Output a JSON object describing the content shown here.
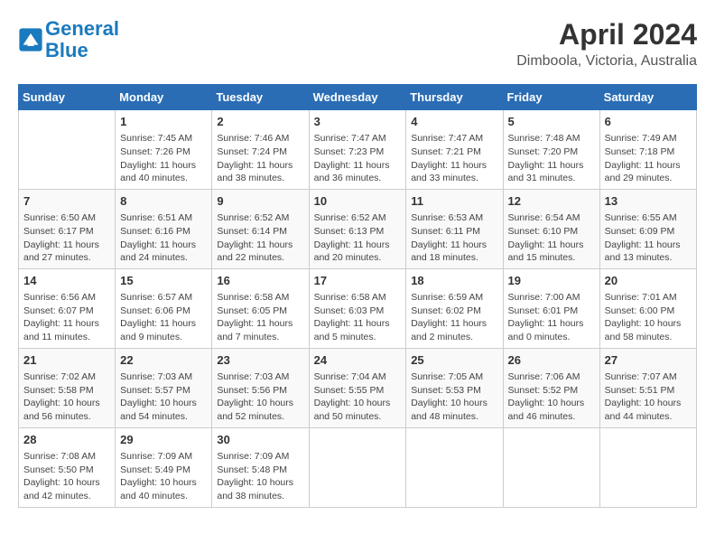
{
  "logo": {
    "line1": "General",
    "line2": "Blue"
  },
  "title": "April 2024",
  "location": "Dimboola, Victoria, Australia",
  "headers": [
    "Sunday",
    "Monday",
    "Tuesday",
    "Wednesday",
    "Thursday",
    "Friday",
    "Saturday"
  ],
  "weeks": [
    [
      {
        "day": "",
        "info": ""
      },
      {
        "day": "1",
        "info": "Sunrise: 7:45 AM\nSunset: 7:26 PM\nDaylight: 11 hours\nand 40 minutes."
      },
      {
        "day": "2",
        "info": "Sunrise: 7:46 AM\nSunset: 7:24 PM\nDaylight: 11 hours\nand 38 minutes."
      },
      {
        "day": "3",
        "info": "Sunrise: 7:47 AM\nSunset: 7:23 PM\nDaylight: 11 hours\nand 36 minutes."
      },
      {
        "day": "4",
        "info": "Sunrise: 7:47 AM\nSunset: 7:21 PM\nDaylight: 11 hours\nand 33 minutes."
      },
      {
        "day": "5",
        "info": "Sunrise: 7:48 AM\nSunset: 7:20 PM\nDaylight: 11 hours\nand 31 minutes."
      },
      {
        "day": "6",
        "info": "Sunrise: 7:49 AM\nSunset: 7:18 PM\nDaylight: 11 hours\nand 29 minutes."
      }
    ],
    [
      {
        "day": "7",
        "info": "Sunrise: 6:50 AM\nSunset: 6:17 PM\nDaylight: 11 hours\nand 27 minutes."
      },
      {
        "day": "8",
        "info": "Sunrise: 6:51 AM\nSunset: 6:16 PM\nDaylight: 11 hours\nand 24 minutes."
      },
      {
        "day": "9",
        "info": "Sunrise: 6:52 AM\nSunset: 6:14 PM\nDaylight: 11 hours\nand 22 minutes."
      },
      {
        "day": "10",
        "info": "Sunrise: 6:52 AM\nSunset: 6:13 PM\nDaylight: 11 hours\nand 20 minutes."
      },
      {
        "day": "11",
        "info": "Sunrise: 6:53 AM\nSunset: 6:11 PM\nDaylight: 11 hours\nand 18 minutes."
      },
      {
        "day": "12",
        "info": "Sunrise: 6:54 AM\nSunset: 6:10 PM\nDaylight: 11 hours\nand 15 minutes."
      },
      {
        "day": "13",
        "info": "Sunrise: 6:55 AM\nSunset: 6:09 PM\nDaylight: 11 hours\nand 13 minutes."
      }
    ],
    [
      {
        "day": "14",
        "info": "Sunrise: 6:56 AM\nSunset: 6:07 PM\nDaylight: 11 hours\nand 11 minutes."
      },
      {
        "day": "15",
        "info": "Sunrise: 6:57 AM\nSunset: 6:06 PM\nDaylight: 11 hours\nand 9 minutes."
      },
      {
        "day": "16",
        "info": "Sunrise: 6:58 AM\nSunset: 6:05 PM\nDaylight: 11 hours\nand 7 minutes."
      },
      {
        "day": "17",
        "info": "Sunrise: 6:58 AM\nSunset: 6:03 PM\nDaylight: 11 hours\nand 5 minutes."
      },
      {
        "day": "18",
        "info": "Sunrise: 6:59 AM\nSunset: 6:02 PM\nDaylight: 11 hours\nand 2 minutes."
      },
      {
        "day": "19",
        "info": "Sunrise: 7:00 AM\nSunset: 6:01 PM\nDaylight: 11 hours\nand 0 minutes."
      },
      {
        "day": "20",
        "info": "Sunrise: 7:01 AM\nSunset: 6:00 PM\nDaylight: 10 hours\nand 58 minutes."
      }
    ],
    [
      {
        "day": "21",
        "info": "Sunrise: 7:02 AM\nSunset: 5:58 PM\nDaylight: 10 hours\nand 56 minutes."
      },
      {
        "day": "22",
        "info": "Sunrise: 7:03 AM\nSunset: 5:57 PM\nDaylight: 10 hours\nand 54 minutes."
      },
      {
        "day": "23",
        "info": "Sunrise: 7:03 AM\nSunset: 5:56 PM\nDaylight: 10 hours\nand 52 minutes."
      },
      {
        "day": "24",
        "info": "Sunrise: 7:04 AM\nSunset: 5:55 PM\nDaylight: 10 hours\nand 50 minutes."
      },
      {
        "day": "25",
        "info": "Sunrise: 7:05 AM\nSunset: 5:53 PM\nDaylight: 10 hours\nand 48 minutes."
      },
      {
        "day": "26",
        "info": "Sunrise: 7:06 AM\nSunset: 5:52 PM\nDaylight: 10 hours\nand 46 minutes."
      },
      {
        "day": "27",
        "info": "Sunrise: 7:07 AM\nSunset: 5:51 PM\nDaylight: 10 hours\nand 44 minutes."
      }
    ],
    [
      {
        "day": "28",
        "info": "Sunrise: 7:08 AM\nSunset: 5:50 PM\nDaylight: 10 hours\nand 42 minutes."
      },
      {
        "day": "29",
        "info": "Sunrise: 7:09 AM\nSunset: 5:49 PM\nDaylight: 10 hours\nand 40 minutes."
      },
      {
        "day": "30",
        "info": "Sunrise: 7:09 AM\nSunset: 5:48 PM\nDaylight: 10 hours\nand 38 minutes."
      },
      {
        "day": "",
        "info": ""
      },
      {
        "day": "",
        "info": ""
      },
      {
        "day": "",
        "info": ""
      },
      {
        "day": "",
        "info": ""
      }
    ]
  ]
}
